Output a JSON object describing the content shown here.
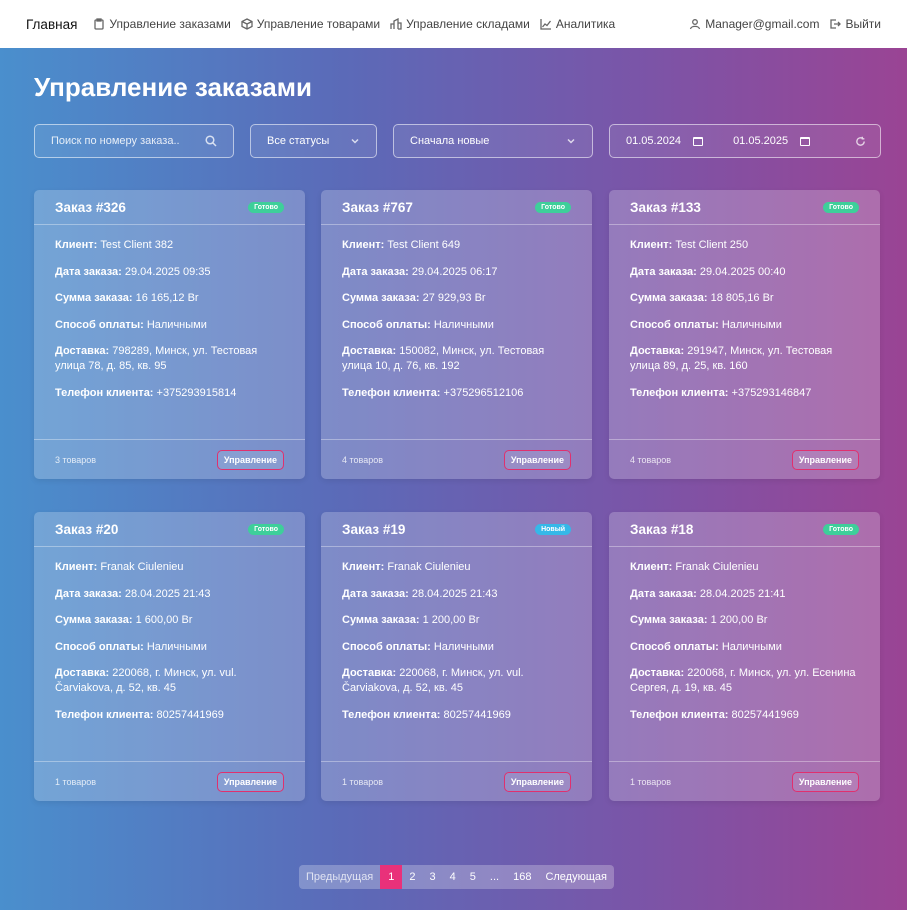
{
  "nav": {
    "brand": "Главная",
    "links": [
      {
        "label": "Управление заказами",
        "icon": "clipboard-icon"
      },
      {
        "label": "Управление товарами",
        "icon": "box-icon"
      },
      {
        "label": "Управление складами",
        "icon": "warehouse-icon"
      },
      {
        "label": "Аналитика",
        "icon": "chart-icon"
      }
    ],
    "user": "Manager@gmail.com",
    "logout": "Выйти"
  },
  "page": {
    "title": "Управление заказами"
  },
  "filters": {
    "search_placeholder": "Поиск по номеру заказа..",
    "status": "Все статусы",
    "sort": "Сначала новые",
    "date_from": "01.05.2024",
    "date_to": "01.05.2025"
  },
  "labels": {
    "client": "Клиент:",
    "date": "Дата заказа:",
    "sum": "Сумма заказа:",
    "payment": "Способ оплаты:",
    "delivery": "Доставка:",
    "phone": "Телефон клиента:",
    "manage": "Управление"
  },
  "orders": [
    {
      "title": "Заказ #326",
      "status": "Готово",
      "client": "Test Client 382",
      "date": "29.04.2025 09:35",
      "sum": "16 165,12 Br",
      "payment": "Наличными",
      "delivery": "798289, Минск, ул. Тестовая улица 78, д. 85, кв. 95",
      "phone": "+375293915814",
      "count": "3 товаров"
    },
    {
      "title": "Заказ #767",
      "status": "Готово",
      "client": "Test Client 649",
      "date": "29.04.2025 06:17",
      "sum": "27 929,93 Br",
      "payment": "Наличными",
      "delivery": "150082, Минск, ул. Тестовая улица 10, д. 76, кв. 192",
      "phone": "+375296512106",
      "count": "4 товаров"
    },
    {
      "title": "Заказ #133",
      "status": "Готово",
      "client": "Test Client 250",
      "date": "29.04.2025 00:40",
      "sum": "18 805,16 Br",
      "payment": "Наличными",
      "delivery": "291947, Минск, ул. Тестовая улица 89, д. 25, кв. 160",
      "phone": "+375293146847",
      "count": "4 товаров"
    },
    {
      "title": "Заказ #20",
      "status": "Готово",
      "client": "Franak Ciulenieu",
      "date": "28.04.2025 21:43",
      "sum": "1 600,00 Br",
      "payment": "Наличными",
      "delivery": "220068, г. Минск, ул. vul. Čarviakova, д. 52, кв. 45",
      "phone": "80257441969",
      "count": "1 товаров"
    },
    {
      "title": "Заказ #19",
      "status": "Новый",
      "client": "Franak Ciulenieu",
      "date": "28.04.2025 21:43",
      "sum": "1 200,00 Br",
      "payment": "Наличными",
      "delivery": "220068, г. Минск, ул. vul. Čarviakova, д. 52, кв. 45",
      "phone": "80257441969",
      "count": "1 товаров"
    },
    {
      "title": "Заказ #18",
      "status": "Готово",
      "client": "Franak Ciulenieu",
      "date": "28.04.2025 21:41",
      "sum": "1 200,00 Br",
      "payment": "Наличными",
      "delivery": "220068, г. Минск, ул. ул. Есенина Сергея, д. 19, кв. 45",
      "phone": "80257441969",
      "count": "1 товаров"
    }
  ],
  "pagination": {
    "prev": "Предыдущая",
    "pages": [
      "1",
      "2",
      "3",
      "4",
      "5",
      "...",
      "168"
    ],
    "current": "1",
    "next": "Следующая"
  },
  "colors": {
    "accent": "#e9317a",
    "badge_done": "#3ecf9a",
    "badge_new": "#35b8e8"
  }
}
